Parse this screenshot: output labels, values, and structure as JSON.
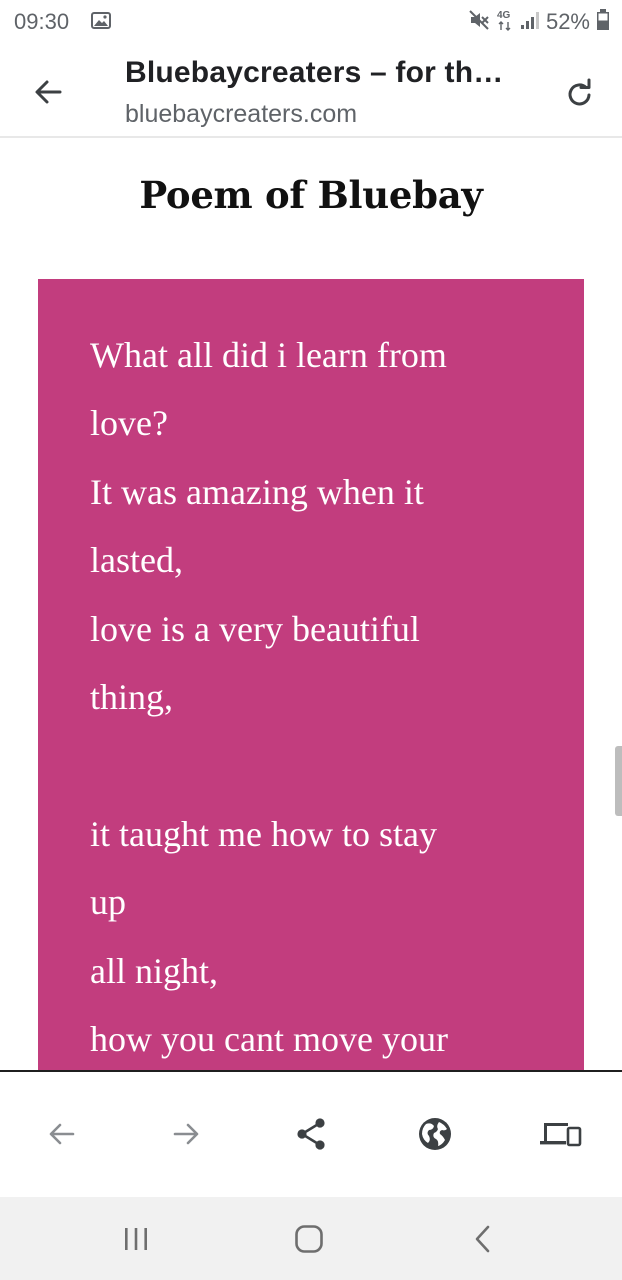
{
  "status_bar": {
    "time": "09:30",
    "network": "4G",
    "battery": "52%",
    "icons": [
      "gallery-icon",
      "mute-icon",
      "network-4g-icon",
      "signal-icon",
      "battery-icon"
    ]
  },
  "browser": {
    "title": "Bluebaycreaters – for th…",
    "url": "bluebaycreaters.com",
    "icons": [
      "back-arrow-icon",
      "reload-icon"
    ]
  },
  "post": {
    "heading": "Poem of Bluebay",
    "block_color": "#c23d7e",
    "lines": [
      "What all did i learn from",
      "love?",
      "It was amazing when it",
      "lasted,",
      "love is a very beautiful",
      "thing,",
      "",
      "it taught me how to stay",
      "up",
      "all night,",
      "how you cant move your"
    ]
  },
  "toolbar": {
    "items": [
      "back-icon",
      "forward-icon",
      "share-icon",
      "globe-icon",
      "devices-icon"
    ]
  },
  "navigation": {
    "items": [
      "recent-apps-icon",
      "home-icon",
      "back-icon"
    ]
  }
}
